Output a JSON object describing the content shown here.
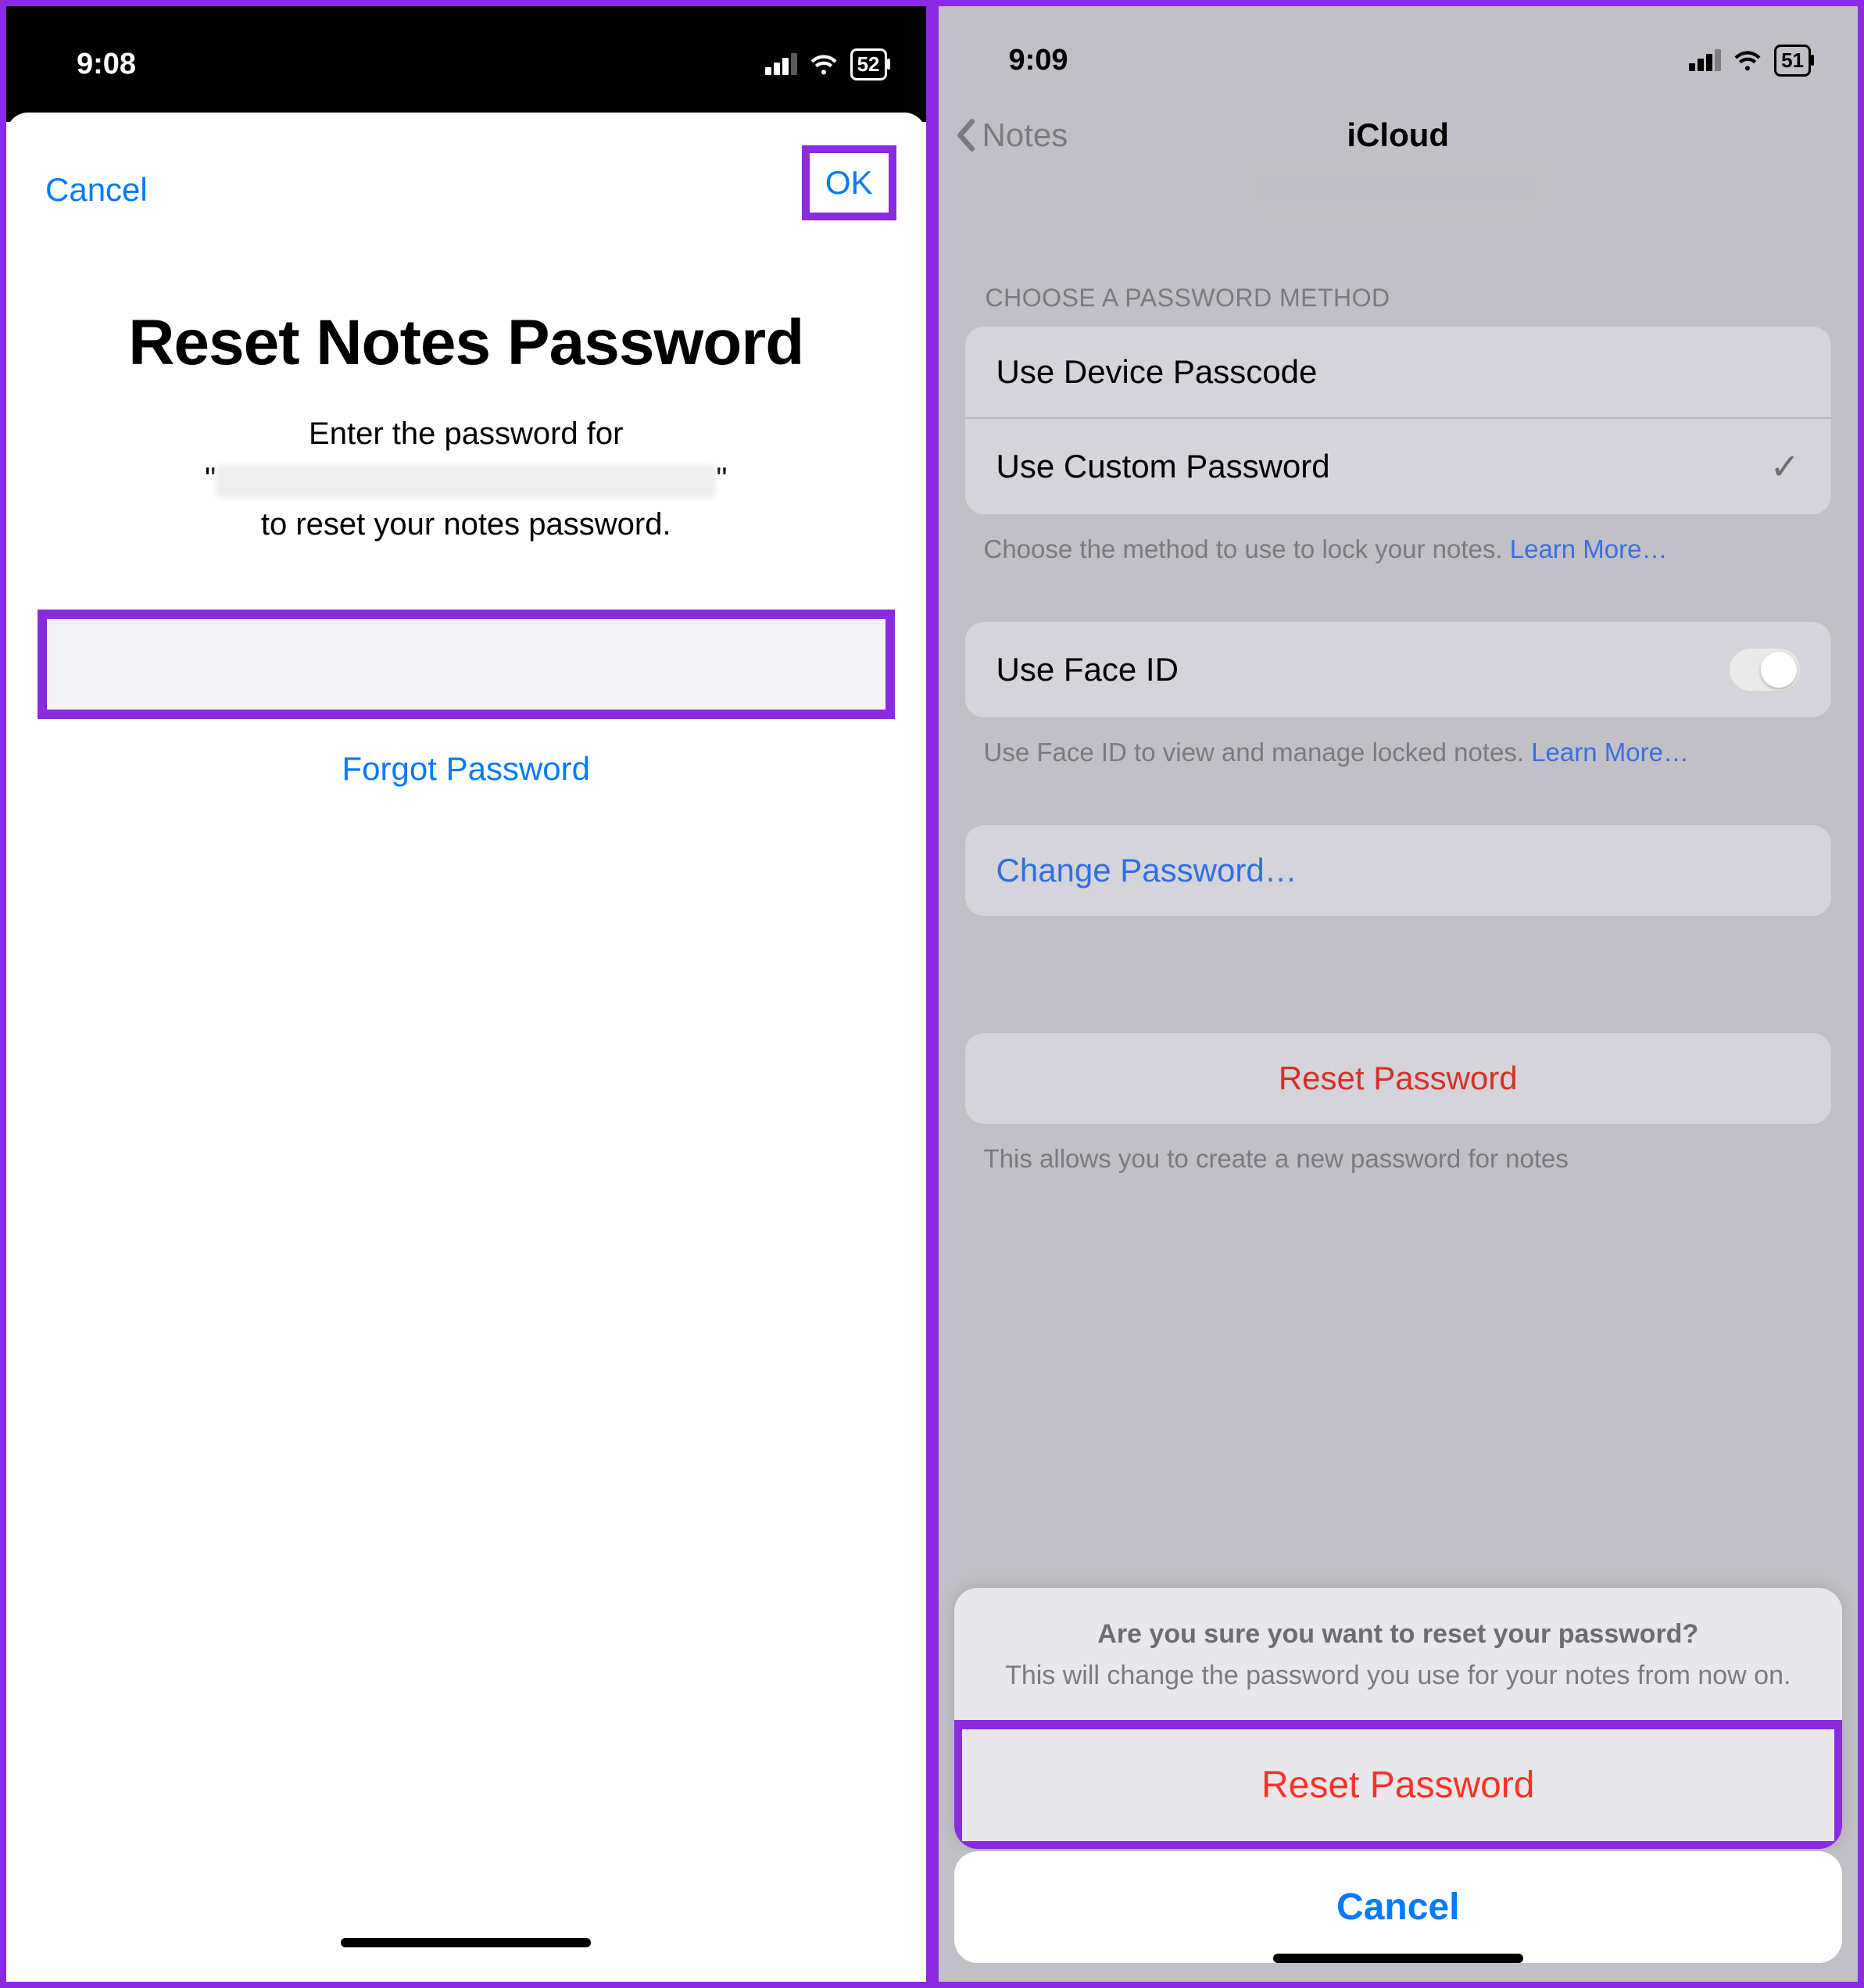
{
  "left": {
    "status": {
      "time": "9:08",
      "battery": "52"
    },
    "nav": {
      "cancel": "Cancel",
      "ok": "OK"
    },
    "title": "Reset Notes Password",
    "sub_line1": "Enter the password for",
    "sub_line3": "to reset your notes password.",
    "password_placeholder": "",
    "forgot": "Forgot Password"
  },
  "right": {
    "status": {
      "time": "9:09",
      "battery": "51"
    },
    "nav": {
      "back": "Notes",
      "title": "iCloud"
    },
    "section1_header": "CHOOSE A PASSWORD METHOD",
    "row_device_passcode": "Use Device Passcode",
    "row_custom_password": "Use Custom Password",
    "footer1_a": "Choose the method to use to lock your notes. ",
    "learn_more": "Learn More…",
    "row_faceid": "Use Face ID",
    "footer2_a": "Use Face ID to view and manage locked notes. ",
    "row_change_pw": "Change Password…",
    "row_reset_pw": "Reset Password",
    "footer_reset": "This allows you to create a new password for notes",
    "sheet": {
      "headline": "Are you sure you want to reset your password?",
      "sub": "This will change the password you use for your notes from now on.",
      "action": "Reset Password",
      "cancel": "Cancel"
    }
  }
}
